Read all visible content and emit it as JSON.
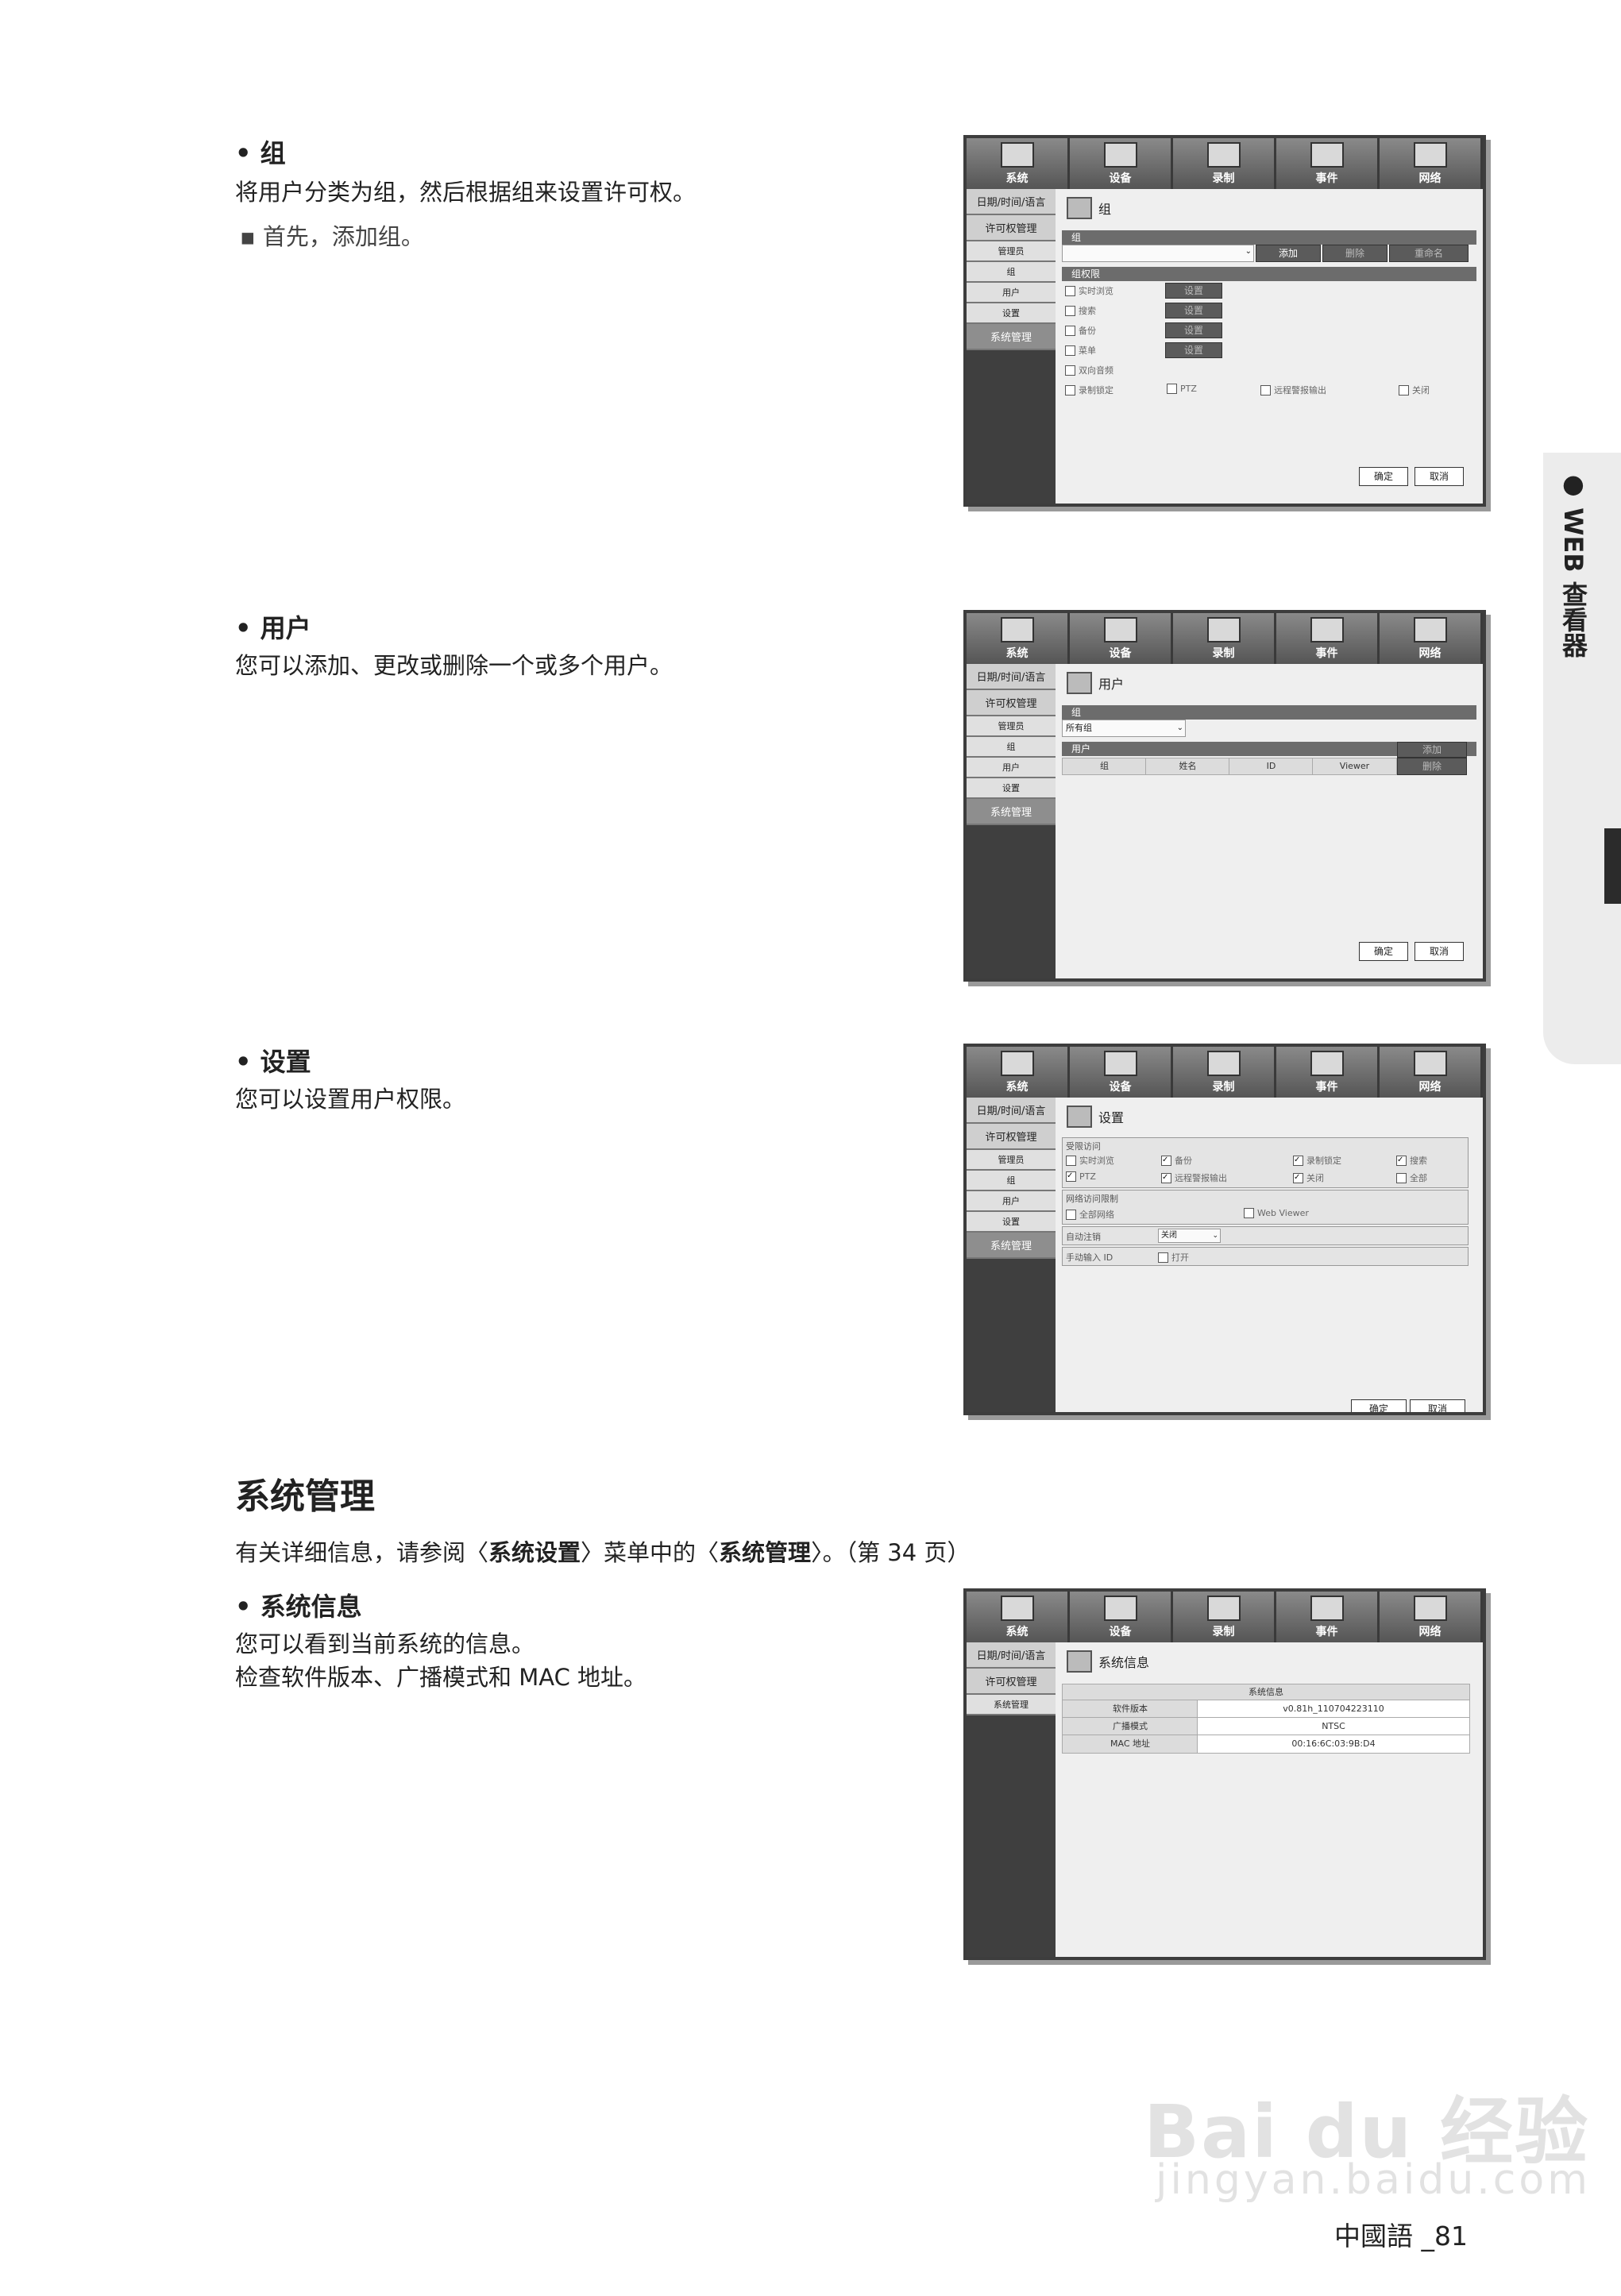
{
  "sections": {
    "group": {
      "heading": "• 组",
      "desc": "将用户分类为组，然后根据组来设置许可权。",
      "note": "▪ 首先，添加组。"
    },
    "user": {
      "heading": "• 用户",
      "desc": "您可以添加、更改或删除一个或多个用户。"
    },
    "settings": {
      "heading": "• 设置",
      "desc": "您可以设置用户权限。"
    },
    "sysmgmt": {
      "title": "系统管理",
      "ref_pre": "有关详细信息，请参阅〈",
      "ref_b1": "系统设置",
      "ref_mid": "〉菜单中的〈",
      "ref_b2": "系统管理",
      "ref_post": "〉。（第 34 页）",
      "info_heading": "• 系统信息",
      "info_l1": "您可以看到当前系统的信息。",
      "info_l2": "检查软件版本、广播模式和 MAC 地址。"
    }
  },
  "side_tab": {
    "label": "● WEB 查看器"
  },
  "topnav": [
    "系统",
    "设备",
    "录制",
    "事件",
    "网络"
  ],
  "sidenav": {
    "datetime": "日期/时间/语言",
    "perm": "许可权管理",
    "admin": "管理员",
    "group": "组",
    "user": "用户",
    "setting": "设置",
    "sysmgmt": "系统管理"
  },
  "screen_group": {
    "title": "组",
    "group_bar": "组",
    "btn_add": "添加",
    "btn_del": "删除",
    "btn_rename": "重命名",
    "perm_bar": "组权限",
    "perms": [
      "实时浏览",
      "搜索",
      "备份",
      "菜单",
      "双向音频"
    ],
    "set_btn": "设置",
    "bottom_perms": [
      "录制锁定",
      "PTZ",
      "远程警报输出",
      "关闭"
    ],
    "ok": "确定",
    "cancel": "取消"
  },
  "screen_user": {
    "title": "用户",
    "group_bar": "组",
    "group_select": "所有组",
    "user_bar": "用户",
    "btn_add": "添加",
    "cols": [
      "组",
      "姓名",
      "ID",
      "Viewer"
    ],
    "btn_del": "删除",
    "ok": "确定",
    "cancel": "取消"
  },
  "screen_setting": {
    "title": "设置",
    "limit_bar": "受限访问",
    "limits_r1": [
      "实时浏览",
      "备份",
      "录制锁定",
      "搜索"
    ],
    "limits_r2": [
      "PTZ",
      "远程警报输出",
      "关闭",
      "全部"
    ],
    "net_bar": "网络访问限制",
    "net_all": "全部网络",
    "net_web": "Web Viewer",
    "auto_logout": "自动注销",
    "auto_logout_val": "关闭",
    "manual_id": "手动输入 ID",
    "manual_id_val": "打开",
    "ok": "确定",
    "cancel": "取消"
  },
  "screen_info": {
    "title": "系统信息",
    "table_head": "系统信息",
    "rows": [
      {
        "label": "软件版本",
        "value": "v0.81h_110704223110"
      },
      {
        "label": "广播模式",
        "value": "NTSC"
      },
      {
        "label": "MAC 地址",
        "value": "00:16:6C:03:9B:D4"
      }
    ]
  },
  "watermark": {
    "main": "Bai du 经验",
    "sub": "jingyan.baidu.com"
  },
  "footer": {
    "page": "中國語 _81"
  }
}
